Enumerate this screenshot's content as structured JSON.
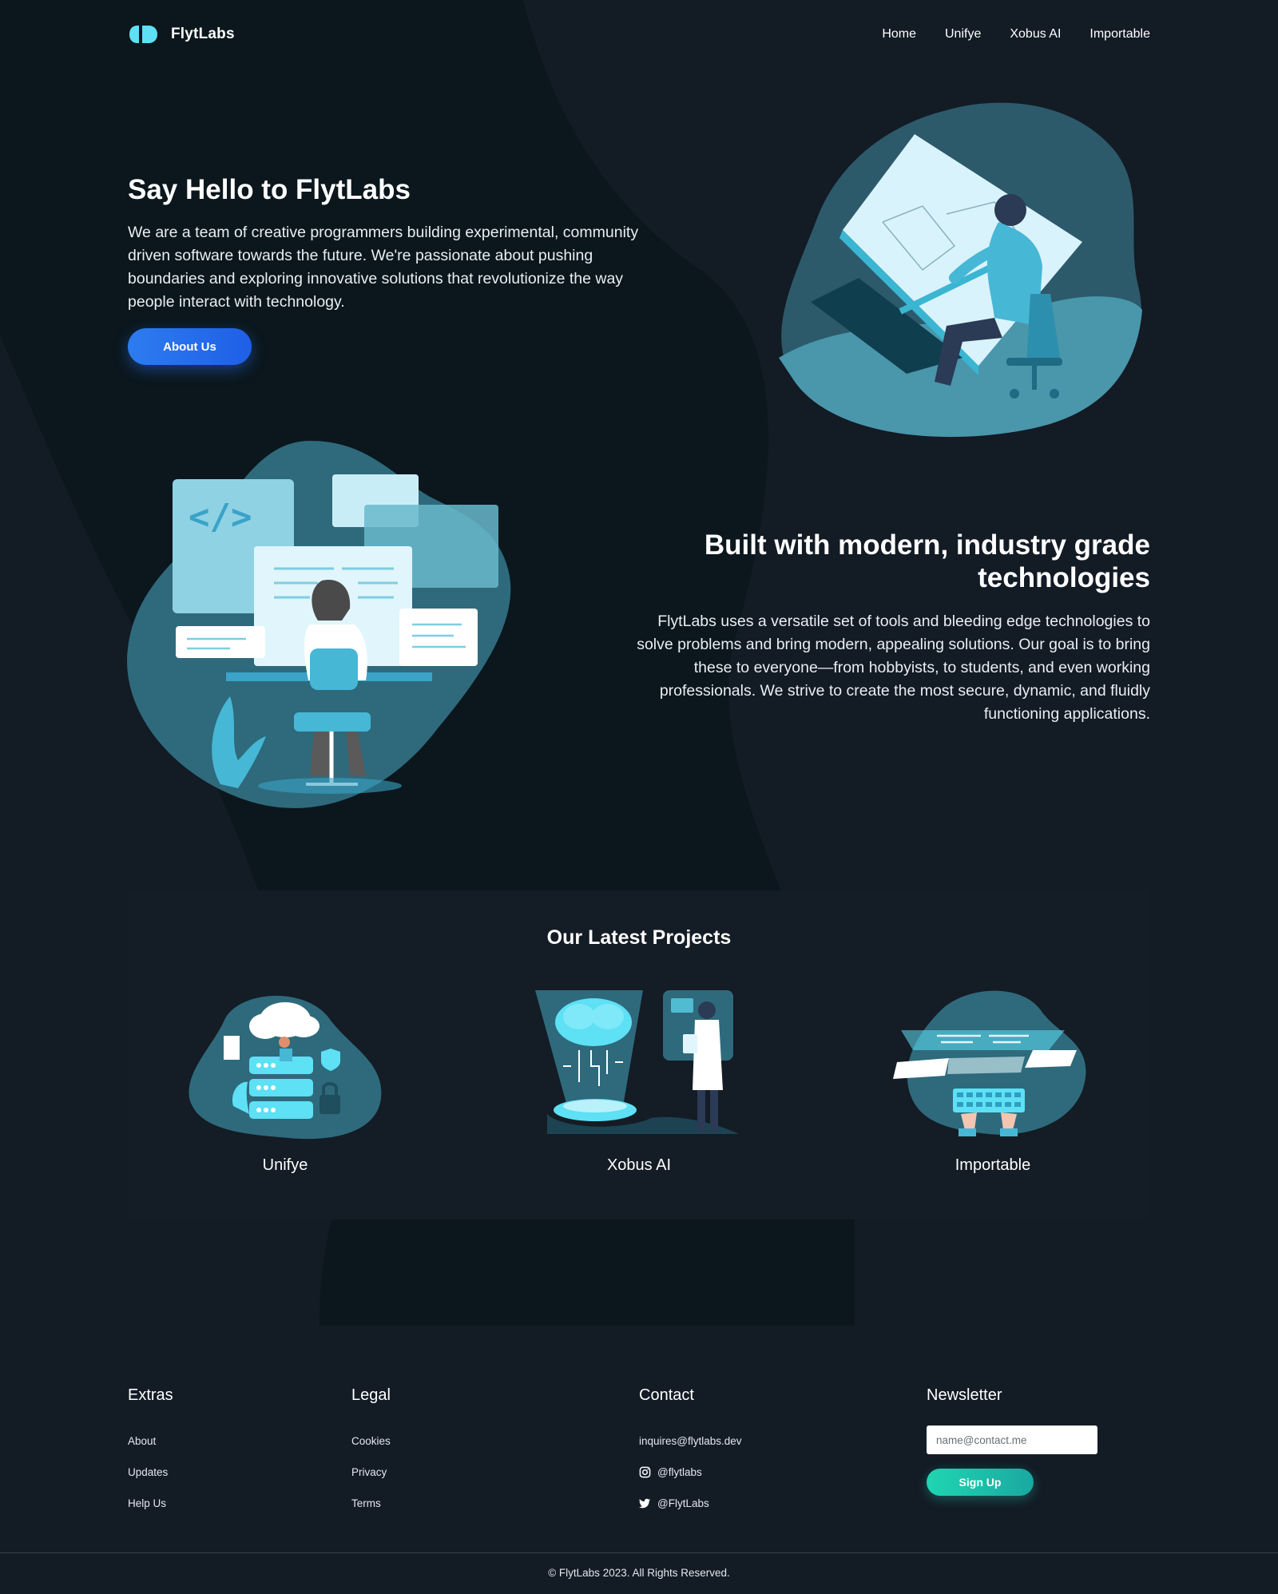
{
  "brand": {
    "name": "FlytLabs",
    "logo_icon": "flytlabs-logo-icon"
  },
  "nav": {
    "items": [
      "Home",
      "Unifye",
      "Xobus AI",
      "Importable"
    ]
  },
  "hero": {
    "title": "Say Hello to FlytLabs",
    "text": "We are a team of creative programmers building experimental, community driven software towards the future. We're passionate about pushing boundaries and exploring innovative solutions that revolutionize the way people interact with technology.",
    "button_label": "About Us",
    "illustration": "designer-at-drafting-table-illustration"
  },
  "tech": {
    "title": "Built with modern, industry grade technologies",
    "text": "FlytLabs uses a versatile set of tools and bleeding edge technologies to solve problems and bring modern, appealing solutions. Our goal is to bring these to everyone—from hobbyists, to students, and even working professionals. We strive to create the most secure, dynamic, and fluidly functioning applications.",
    "illustration": "developer-at-screens-illustration"
  },
  "projects": {
    "title": "Our Latest Projects",
    "items": [
      {
        "name": "Unifye",
        "illustration": "cloud-server-illustration"
      },
      {
        "name": "Xobus AI",
        "illustration": "ai-brain-scientist-illustration"
      },
      {
        "name": "Importable",
        "illustration": "keyboard-code-illustration"
      }
    ]
  },
  "footer": {
    "extras": {
      "heading": "Extras",
      "links": [
        "About",
        "Updates",
        "Help Us"
      ]
    },
    "legal": {
      "heading": "Legal",
      "links": [
        "Cookies",
        "Privacy",
        "Terms"
      ]
    },
    "contact": {
      "heading": "Contact",
      "email": "inquires@flytlabs.dev",
      "instagram": "@flytlabs",
      "twitter": "@FlytLabs"
    },
    "newsletter": {
      "heading": "Newsletter",
      "placeholder": "name@contact.me",
      "button_label": "Sign Up"
    },
    "copyright": "© FlytLabs 2023. All Rights Reserved."
  },
  "colors": {
    "background": "#131b25",
    "shape_dark": "#0b171d",
    "accent_cyan": "#5ee0f5",
    "button_blue": "#2d7cf0",
    "button_teal": "#1fd6b2"
  }
}
